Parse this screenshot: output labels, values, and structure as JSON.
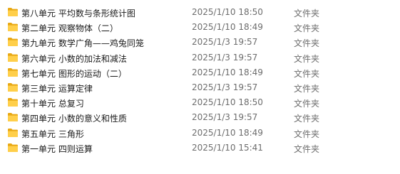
{
  "colors": {
    "folder_back": "#E8A814",
    "folder_front": "#FFCF4A",
    "name_text": "#1A1A1A",
    "meta_text": "#6D6D6D"
  },
  "folder_icon": "folder-icon",
  "files": [
    {
      "name": "第八单元  平均数与条形统计图",
      "date": "2025/1/10 18:50",
      "type": "文件夹"
    },
    {
      "name": "第二单元  观察物体（二）",
      "date": "2025/1/10 18:49",
      "type": "文件夹"
    },
    {
      "name": "第九单元  数学广角——鸡兔同笼",
      "date": "2025/1/3 19:57",
      "type": "文件夹"
    },
    {
      "name": "第六单元  小数的加法和减法",
      "date": "2025/1/3 19:57",
      "type": "文件夹"
    },
    {
      "name": "第七单元  图形的运动（二）",
      "date": "2025/1/10 18:49",
      "type": "文件夹"
    },
    {
      "name": "第三单元  运算定律",
      "date": "2025/1/3 19:57",
      "type": "文件夹"
    },
    {
      "name": "第十单元  总复习",
      "date": "2025/1/10 18:50",
      "type": "文件夹"
    },
    {
      "name": "第四单元  小数的意义和性质",
      "date": "2025/1/3 19:57",
      "type": "文件夹"
    },
    {
      "name": "第五单元  三角形",
      "date": "2025/1/10 18:49",
      "type": "文件夹"
    },
    {
      "name": "第一单元  四则运算",
      "date": "2025/1/10 15:41",
      "type": "文件夹"
    }
  ]
}
